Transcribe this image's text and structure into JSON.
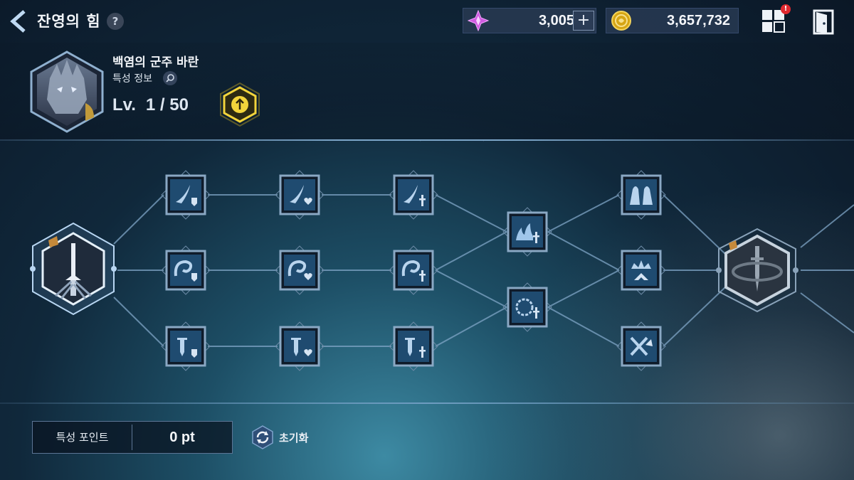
{
  "header": {
    "title": "잔영의 힘",
    "help_label": "?",
    "notification_badge": "!"
  },
  "currencies": {
    "gem_value": "3,005",
    "gold_value": "3,657,732",
    "plus_label": "+"
  },
  "character": {
    "name": "백염의 군주 바란",
    "trait_info_label": "특성 정보",
    "level_prefix": "Lv.",
    "level_value": "1 / 50"
  },
  "tree": {
    "row_top": [
      "sword-slash-shield",
      "sword-slash-heart",
      "sword-slash-dagger",
      "hooded-figures"
    ],
    "row_mid": [
      "swirl-shield",
      "swirl-heart",
      "swirl-dagger",
      "crown-arrow"
    ],
    "row_bottom": [
      "sword-shield",
      "sword-heart",
      "sword-dagger",
      "crossed-swords-arrow"
    ],
    "center_nodes": [
      "flames-dagger",
      "ring-dagger"
    ],
    "root_node": "greatsword",
    "end_node": "greatsword-vortex"
  },
  "footer": {
    "points_label": "특성 포인트",
    "points_value": "0 pt",
    "reset_label": "초기화"
  },
  "colors": {
    "accent_gold": "#f2d43b",
    "node_frame": "#8aa8c4",
    "badge_red": "#e0292f"
  }
}
